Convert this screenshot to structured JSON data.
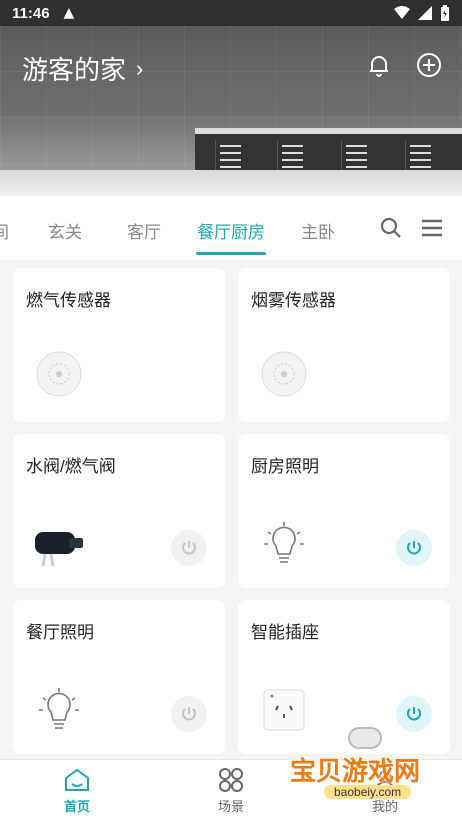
{
  "status_bar": {
    "time": "11:46"
  },
  "header": {
    "home_title": "游客的家",
    "chevron": "›"
  },
  "tabs": {
    "items": [
      {
        "label": "间"
      },
      {
        "label": "玄关"
      },
      {
        "label": "客厅"
      },
      {
        "label": "餐厅厨房",
        "active": true
      },
      {
        "label": "主卧"
      }
    ]
  },
  "cards": [
    {
      "title": "燃气传感器",
      "device_icon": "gas-sensor-icon"
    },
    {
      "title": "烟雾传感器",
      "device_icon": "smoke-sensor-icon"
    },
    {
      "title": "水阀/燃气阀",
      "device_icon": "valve-icon",
      "power": "off"
    },
    {
      "title": "厨房照明",
      "device_icon": "bulb-icon",
      "power": "on"
    },
    {
      "title": "餐厅照明",
      "device_icon": "bulb-icon",
      "power": "off"
    },
    {
      "title": "智能插座",
      "device_icon": "socket-icon",
      "power": "on"
    }
  ],
  "bottom_nav": {
    "home": "首页",
    "scene": "场景",
    "mine": "我的"
  },
  "watermark": {
    "text": "宝贝游戏网",
    "url": "baobeiy.com"
  },
  "colors": {
    "accent": "#1ba9b3",
    "status_bar": "#2f2f2f"
  }
}
